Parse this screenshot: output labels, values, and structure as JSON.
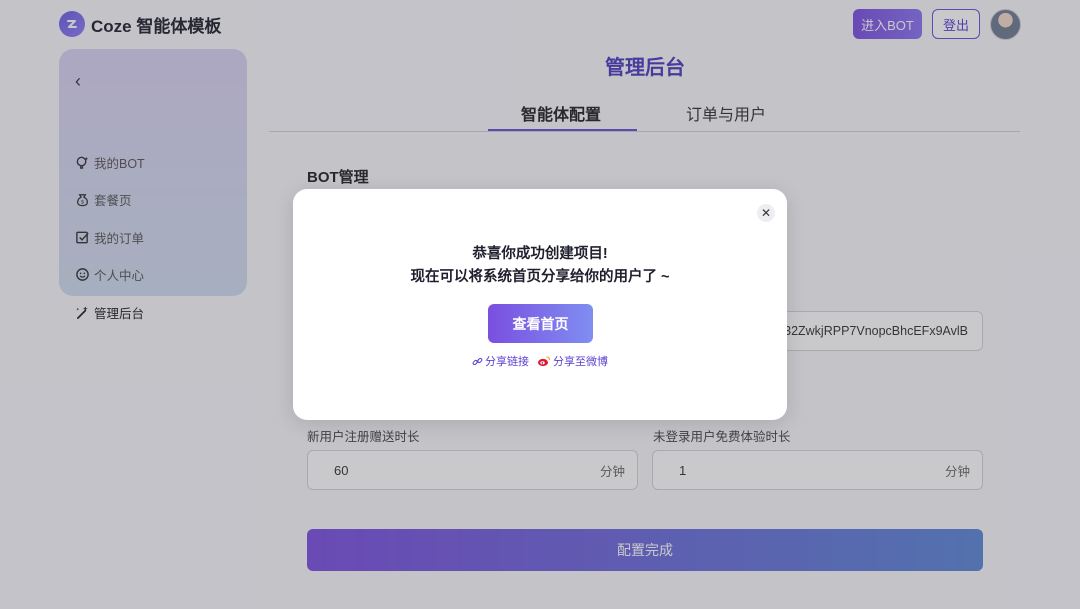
{
  "header": {
    "app_title": "Coze 智能体模板",
    "enter_bot_label": "进入BOT",
    "logout_label": "登出"
  },
  "sidebar": {
    "items": [
      {
        "label": "我的BOT",
        "icon": "bulb-star-icon"
      },
      {
        "label": "套餐页",
        "icon": "money-bag-icon"
      },
      {
        "label": "我的订单",
        "icon": "order-check-icon"
      },
      {
        "label": "个人中心",
        "icon": "smile-icon"
      },
      {
        "label": "管理后台",
        "icon": "magic-wand-icon"
      }
    ]
  },
  "main": {
    "title": "管理后台",
    "tabs": [
      {
        "label": "智能体配置",
        "active": true
      },
      {
        "label": "订单与用户",
        "active": false
      }
    ],
    "section_title": "BOT管理",
    "token_value": "S32ZwkjRPP7VnopcBhcEFx9AvlB",
    "fields": [
      {
        "label": "新用户注册赠送时长",
        "value": "60",
        "unit": "分钟"
      },
      {
        "label": "未登录用户免费体验时长",
        "value": "1",
        "unit": "分钟"
      }
    ],
    "submit_label": "配置完成"
  },
  "modal": {
    "line1": "恭喜你成功创建项目!",
    "line2": "现在可以将系统首页分享给你的用户了 ~",
    "home_button": "查看首页",
    "share_link": "分享链接",
    "share_weibo": "分享至微博"
  },
  "colors": {
    "accent": "#6a4fd6",
    "title": "#4b3bbf"
  }
}
